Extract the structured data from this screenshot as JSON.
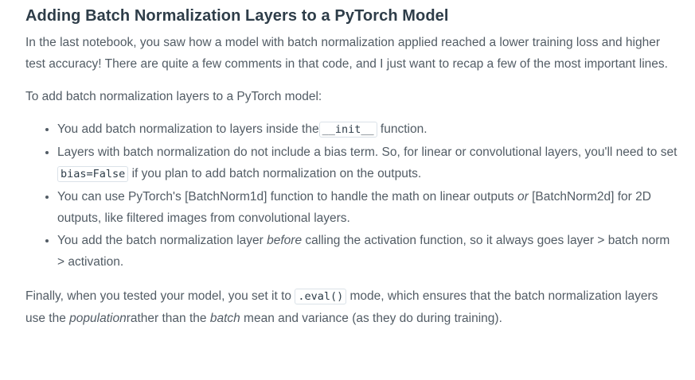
{
  "title": "Adding Batch Normalization Layers to a PyTorch Model",
  "intro": "In the last notebook, you saw how a model with batch normalization applied reached a lower training loss and higher test accuracy! There are quite a few comments in that code, and I just want to recap a few of the most important lines.",
  "lead": "To add batch normalization layers to a PyTorch model:",
  "bullets": {
    "b1": {
      "pre": "You add batch normalization to layers inside the",
      "code": "__init__",
      "post": " function."
    },
    "b2": {
      "pre": "Layers with batch normalization do not include a bias term. So, for linear or convolutional layers, you'll need to set ",
      "code": "bias=False",
      "post": " if you plan to add batch normalization on the outputs."
    },
    "b3": {
      "pre": "You can use PyTorch's [BatchNorm1d] function to handle the math on linear outputs ",
      "em": "or",
      "post": " [BatchNorm2d] for 2D outputs, like filtered images from convolutional layers."
    },
    "b4": {
      "pre": "You add the batch normalization layer ",
      "em": "before",
      "post": " calling the activation function, so it always goes layer > batch norm > activation."
    }
  },
  "final": {
    "pre": "Finally, when you tested your model, you set it to ",
    "code": ".eval()",
    "mid": " mode, which ensures that the batch normalization layers use the ",
    "em1": "population",
    "mid2": "rather than the ",
    "em2": "batch",
    "post": " mean and variance (as they do during training)."
  }
}
